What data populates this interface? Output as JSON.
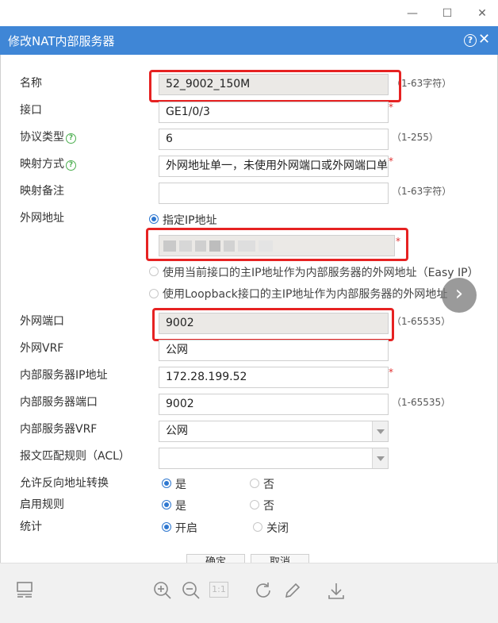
{
  "window": {
    "minimize_glyph": "—",
    "maximize_glyph": "☐",
    "close_glyph": "✕"
  },
  "dialog": {
    "title": "修改NAT内部服务器",
    "help_glyph": "?",
    "close_glyph": "✕",
    "accent_color": "#3f86d6"
  },
  "fields": {
    "name": {
      "label": "名称",
      "value": "52_9002_150M",
      "hint": "（1-63字符）"
    },
    "interface": {
      "label": "接口",
      "value": "GE1/0/3",
      "required": "*"
    },
    "protocol": {
      "label": "协议类型",
      "value": "6",
      "hint": "（1-255）"
    },
    "mapping_mode": {
      "label": "映射方式",
      "value": "外网地址单一，未使用外网端口或外网端口单",
      "required": "*"
    },
    "mapping_note": {
      "label": "映射备注",
      "value": "",
      "hint": "（1-63字符）"
    },
    "external_address": {
      "label": "外网地址",
      "option_specify": "指定IP地址",
      "required": "*",
      "option_current_interface": "使用当前接口的主IP地址作为内部服务器的外网地址（Easy IP）",
      "option_loopback": "使用Loopback接口的主IP地址作为内部服务器的外网地址"
    },
    "external_port": {
      "label": "外网端口",
      "value": "9002",
      "hint": "（1-65535）"
    },
    "external_vrf": {
      "label": "外网VRF",
      "value": "公网"
    },
    "internal_ip": {
      "label": "内部服务器IP地址",
      "value": "172.28.199.52",
      "required": "*"
    },
    "internal_port": {
      "label": "内部服务器端口",
      "value": "9002",
      "hint": "（1-65535）"
    },
    "internal_vrf": {
      "label": "内部服务器VRF",
      "value": "公网"
    },
    "acl": {
      "label": "报文匹配规则（ACL）",
      "value": ""
    },
    "reverse_nat": {
      "label": "允许反向地址转换",
      "yes": "是",
      "no": "否"
    },
    "enable_rule": {
      "label": "启用规则",
      "yes": "是",
      "no": "否"
    },
    "statistics": {
      "label": "统计",
      "on": "开启",
      "off": "关闭"
    }
  },
  "buttons": {
    "confirm": "确定",
    "cancel": "取消"
  },
  "toolbar": {
    "icons": [
      "thumbnail-view-icon",
      "zoom-in-icon",
      "zoom-out-icon",
      "actual-size-icon",
      "rotate-icon",
      "edit-icon",
      "download-icon"
    ],
    "actual_size_label": "1:1"
  }
}
